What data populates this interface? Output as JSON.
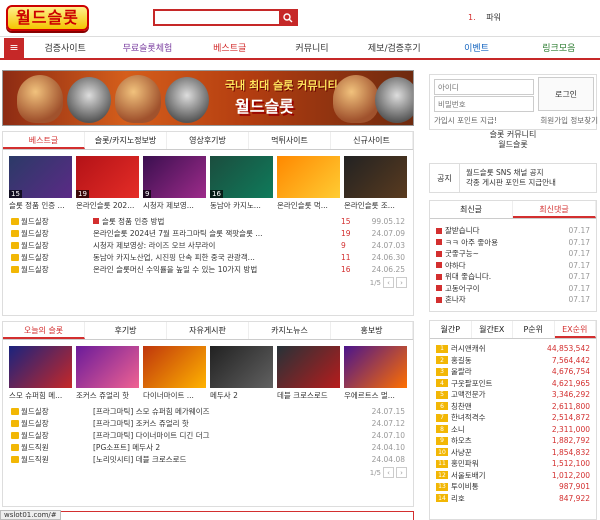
{
  "header": {
    "logo": "월드슬롯",
    "search_placeholder": "",
    "rank_num": "1.",
    "rank_word": "파워"
  },
  "nav": {
    "items": [
      {
        "label": "검증사이트",
        "color": "#333333"
      },
      {
        "label": "무료슬롯체험",
        "color": "#7b3fa0"
      },
      {
        "label": "베스트글",
        "color": "#d32f2f"
      },
      {
        "label": "커뮤니티",
        "color": "#333333"
      },
      {
        "label": "제보/검증후기",
        "color": "#333333"
      },
      {
        "label": "이벤트",
        "color": "#1565c0"
      },
      {
        "label": "링크모음",
        "color": "#2e7d32"
      }
    ]
  },
  "banner": {
    "line1": "국내 최대 슬롯 커뮤니티",
    "line2": "월드슬롯"
  },
  "best": {
    "tabs": [
      "베스트글",
      "슬롯/카지노정보방",
      "영상후기방",
      "먹튀사이트",
      "신규사이트"
    ],
    "thumbs": [
      {
        "num": "15",
        "caption": "슬롯 정품 인증 ...",
        "bg": "linear-gradient(135deg,#2b3a67,#5b2a86)"
      },
      {
        "num": "19",
        "caption": "온라인슬롯 202...",
        "bg": "linear-gradient(135deg,#b31217,#e52d27)"
      },
      {
        "num": "9",
        "caption": "시청자 제보영...",
        "bg": "linear-gradient(135deg,#3a0f4f,#9d2b8a)"
      },
      {
        "num": "16",
        "caption": "동남아 카지노...",
        "bg": "linear-gradient(135deg,#1b4d3e,#0f7b5b)"
      },
      {
        "num": "",
        "caption": "온라인슬롯 먹...",
        "bg": "linear-gradient(135deg,#ff8800,#ffcc33)"
      },
      {
        "num": "",
        "caption": "온라인슬롯 조...",
        "bg": "linear-gradient(135deg,#222,#5a3b1f)"
      }
    ],
    "rows": [
      {
        "author": "월드실장",
        "title": "슬롯 정품 인증 방법",
        "comments": "15",
        "date": "99.05.12"
      },
      {
        "author": "월드실장",
        "title": "온라인슬롯 2024년 7월 프라그마틱 슬롯 잭팟슬롯 ...",
        "comments": "19",
        "date": "24.07.09"
      },
      {
        "author": "월드실장",
        "title": "시청자 제보영상: 라이즈 오브 사무라이",
        "comments": "9",
        "date": "24.07.03"
      },
      {
        "author": "월드실장",
        "title": "동남아 카지노산업, 시진핑 단속 피한 중국 관광객...",
        "comments": "11",
        "date": "24.06.30"
      },
      {
        "author": "월드실장",
        "title": "온라인 슬롯머신 수익률을 높일 수 있는 10가지 방법",
        "comments": "16",
        "date": "24.06.25"
      }
    ],
    "page": "1/5"
  },
  "today": {
    "tabs": [
      "오늘의 슬롯",
      "후기방",
      "자유게시판",
      "카지노뉴스",
      "홍보방"
    ],
    "thumbs": [
      {
        "caption": "스모 슈퍼힘 메...",
        "bg": "linear-gradient(135deg,#1a237e,#c62828)"
      },
      {
        "caption": "조커스 쥬얼리 핫",
        "bg": "linear-gradient(135deg,#6a1b9a,#f06292)"
      },
      {
        "caption": "다이너마이트 ...",
        "bg": "linear-gradient(135deg,#bf360c,#ffb300)"
      },
      {
        "caption": "메두사 2",
        "bg": "linear-gradient(135deg,#212121,#616161)"
      },
      {
        "caption": "데블 크로스로드",
        "bg": "linear-gradient(135deg,#263238,#b71c1c)"
      },
      {
        "caption": "우에르트스 멀...",
        "bg": "linear-gradient(135deg,#4a148c,#ff6f00)"
      }
    ],
    "rows": [
      {
        "author": "월드실장",
        "title": "[프라그마틱] 스모 슈퍼힘 메가웨이즈",
        "date": "24.07.15"
      },
      {
        "author": "월드실장",
        "title": "[프라그마틱] 조커스 쥬얼리 핫",
        "date": "24.07.12"
      },
      {
        "author": "월드실장",
        "title": "[프라그마틱] 다이너마이트 디긴 더그",
        "date": "24.07.10"
      },
      {
        "author": "월드직원",
        "title": "[PG소프트] 메두사 2",
        "date": "24.04.10"
      },
      {
        "author": "월드직원",
        "title": "[노리밋시티] 데블 크로스로드",
        "date": "24.04.08"
      }
    ],
    "page": "1/5"
  },
  "login": {
    "id_placeholder": "아이디",
    "pw_placeholder": "비밀번호",
    "button": "로그인",
    "join_point": "가입시 포인트 지급!",
    "join_info": "회원가입 정보찾기"
  },
  "community": {
    "line1": "슬롯 커뮤니티",
    "line2": "월드슬롯"
  },
  "notice": {
    "label": "공지",
    "line1": "월드슬롯 SNS 채널 공지",
    "line2": "각종 게시판 포인트 지급안내"
  },
  "recent": {
    "tabs": [
      "최신글",
      "최신댓글"
    ],
    "items": [
      {
        "title": "잘받습니다",
        "date": "07.17"
      },
      {
        "title": "ㅋㅋ 아주 좋아용",
        "date": "07.17"
      },
      {
        "title": "굿좋구능~",
        "date": "07.17"
      },
      {
        "title": "야하다",
        "date": "07.17"
      },
      {
        "title": "위대 좋습니다.",
        "date": "07.17"
      },
      {
        "title": "고동어구이",
        "date": "07.17"
      },
      {
        "title": "혼나자",
        "date": "07.17"
      }
    ]
  },
  "ranking": {
    "tabs": [
      "월간P",
      "월간EX",
      "P순위",
      "EX순위"
    ],
    "items": [
      {
        "n": "1",
        "name": "러시앤캐쉬",
        "value": "44,853,542"
      },
      {
        "n": "2",
        "name": "홍길동",
        "value": "7,564,442"
      },
      {
        "n": "3",
        "name": "울랄라",
        "value": "4,676,754"
      },
      {
        "n": "4",
        "name": "구웃팔포인트",
        "value": "4,621,965"
      },
      {
        "n": "5",
        "name": "고맥전문가",
        "value": "3,346,292"
      },
      {
        "n": "6",
        "name": "칭찬맨",
        "value": "2,611,800"
      },
      {
        "n": "7",
        "name": "한녀적격수",
        "value": "2,514,872"
      },
      {
        "n": "8",
        "name": "소니",
        "value": "2,311,000"
      },
      {
        "n": "9",
        "name": "하오츠",
        "value": "1,882,792"
      },
      {
        "n": "10",
        "name": "사냥꾼",
        "value": "1,854,832"
      },
      {
        "n": "11",
        "name": "홍민파워",
        "value": "1,512,100"
      },
      {
        "n": "12",
        "name": "서울토배기",
        "value": "1,012,200"
      },
      {
        "n": "13",
        "name": "투이비통",
        "value": "987,901"
      },
      {
        "n": "14",
        "name": "리호",
        "value": "847,922"
      }
    ]
  },
  "status": "wslot01.com/#"
}
